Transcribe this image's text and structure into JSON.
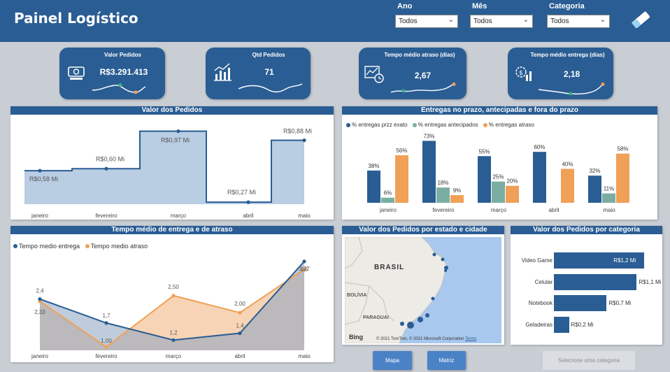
{
  "header": {
    "title": "Painel Logístico"
  },
  "filters": [
    {
      "label": "Ano",
      "value": "Todos"
    },
    {
      "label": "Mês",
      "value": "Todos"
    },
    {
      "label": "Categoria",
      "value": "Todos"
    }
  ],
  "kpis": [
    {
      "title": "Valor Pedidos",
      "value": "R$3.291.413",
      "icon": "money-icon"
    },
    {
      "title": "Qtd Pedidos",
      "value": "71",
      "icon": "bar-chart-icon"
    },
    {
      "title": "Tempo médio atraso (dias)",
      "value": "2,67",
      "icon": "delivery-chart-icon"
    },
    {
      "title": "Tempo médio entrega (dias)",
      "value": "2,18",
      "icon": "gear-money-icon"
    }
  ],
  "panels": {
    "valor": "Valor dos Pedidos",
    "entregas": "Entregas no prazo, antecipadas e fora do prazo",
    "tempo": "Tempo médio de entrega e de atraso",
    "mapa": "Valor dos Pedidos por estado e cidade",
    "categoria": "Valor dos Pedidos por categoria"
  },
  "map": {
    "country_label": "BRASIL",
    "labels": [
      "BOLÍVIA",
      "PARAGUAI"
    ],
    "credit": "© 2021 TomTom, © 2021 Microsoft Corporation",
    "terms": "Terms",
    "bing": "Bing"
  },
  "buttons": {
    "mapa": "Mapa",
    "matriz": "Matriz",
    "selecione": "Selecione uma categoria"
  },
  "colors": {
    "blue": "#2a5d93",
    "teal": "#7aaea2",
    "orange": "#f0a057",
    "light_blue": "#b9cde3"
  },
  "chart_data": [
    {
      "type": "area",
      "title": "Valor dos Pedidos",
      "categories": [
        "janeiro",
        "fevereiro",
        "março",
        "abril",
        "maio"
      ],
      "values": [
        0.58,
        0.6,
        0.97,
        0.27,
        0.88
      ],
      "labels": [
        "R$0,58 Mi",
        "R$0,60 Mi",
        "R$0,97 Mi",
        "R$0,27 Mi",
        "R$0,88 Mi"
      ],
      "ylim": [
        0.25,
        1.05
      ]
    },
    {
      "type": "bar",
      "title": "Entregas no prazo, antecipadas e fora do prazo",
      "categories": [
        "janeiro",
        "fevereiro",
        "março",
        "abril",
        "maio"
      ],
      "series": [
        {
          "name": "% entregas przz exato",
          "values": [
            38,
            73,
            55,
            60,
            32
          ],
          "labels": [
            "38%",
            "73%",
            "55%",
            "60%",
            "32%"
          ]
        },
        {
          "name": "% entregas antecipados",
          "values": [
            6,
            18,
            25,
            null,
            11
          ],
          "labels": [
            "6%",
            "18%",
            "25%",
            "",
            "11%"
          ]
        },
        {
          "name": "% entregas atraso",
          "values": [
            56,
            9,
            20,
            40,
            58
          ],
          "labels": [
            "56%",
            "9%",
            "20%",
            "40%",
            "58%"
          ]
        }
      ],
      "ylim": [
        0,
        75
      ]
    },
    {
      "type": "area",
      "title": "Tempo médio de entrega e de atraso",
      "categories": [
        "janeiro",
        "fevereiro",
        "março",
        "abril",
        "maio"
      ],
      "series": [
        {
          "name": "Tempo medio entrega",
          "values": [
            2.4,
            1.7,
            1.2,
            1.4,
            3.5
          ],
          "labels": [
            "2,4",
            "1,7",
            "1,2",
            "1,4",
            "3,5"
          ]
        },
        {
          "name": "Tempo medio atraso",
          "values": [
            2.33,
            1.0,
            2.5,
            2.0,
            3.27
          ],
          "labels": [
            "2,33",
            "1,00",
            "2,50",
            "2,00",
            "3,27"
          ]
        }
      ],
      "ylim": [
        0.9,
        3.6
      ]
    },
    {
      "type": "bar",
      "orientation": "horizontal",
      "title": "Valor dos Pedidos por categoria",
      "categories": [
        "Video Game",
        "Celular",
        "Notebook",
        "Geladeiras"
      ],
      "values": [
        1.2,
        1.1,
        0.7,
        0.2
      ],
      "labels": [
        "R$1,2 Mi",
        "R$1,1 Mi",
        "R$0,7 Mi",
        "R$0,2 Mi"
      ],
      "xlim": [
        0,
        1.3
      ]
    }
  ]
}
